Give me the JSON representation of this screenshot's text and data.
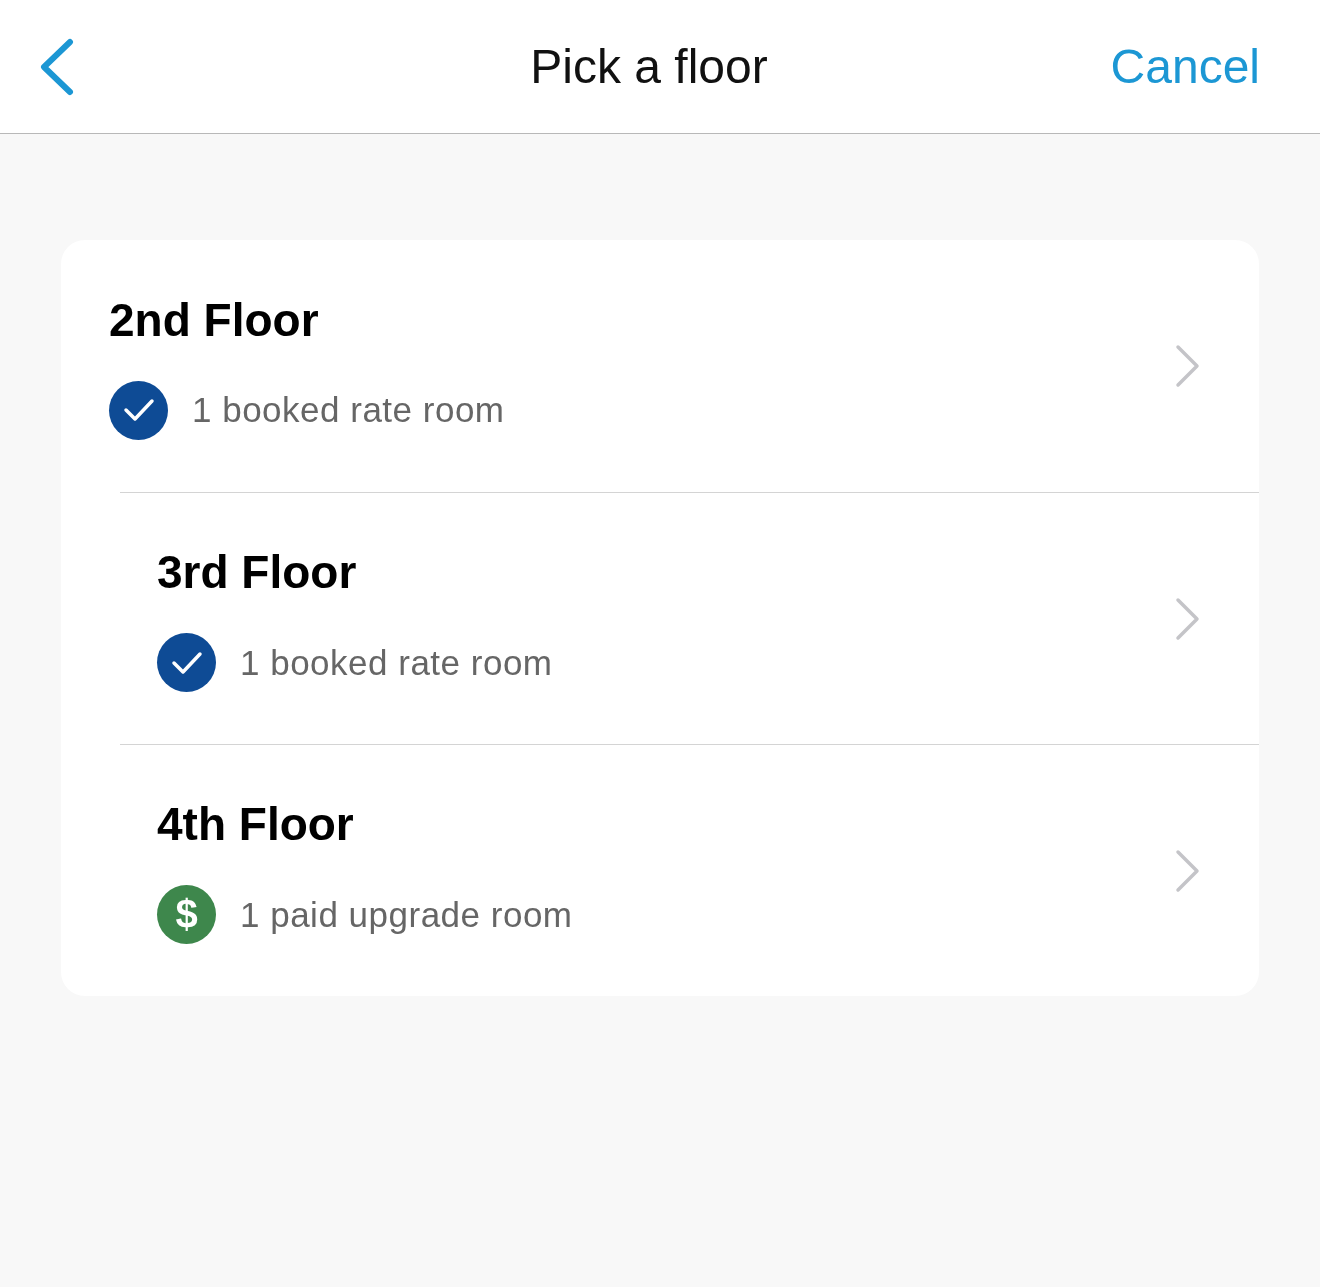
{
  "header": {
    "title": "Pick a floor",
    "cancel": "Cancel"
  },
  "floors": [
    {
      "name": "2nd Floor",
      "kind": "booked",
      "note": "1 booked rate room"
    },
    {
      "name": "3rd Floor",
      "kind": "booked",
      "note": "1 booked rate room"
    },
    {
      "name": "4th Floor",
      "kind": "paid",
      "note": "1 paid upgrade room",
      "symbol": "$"
    }
  ]
}
